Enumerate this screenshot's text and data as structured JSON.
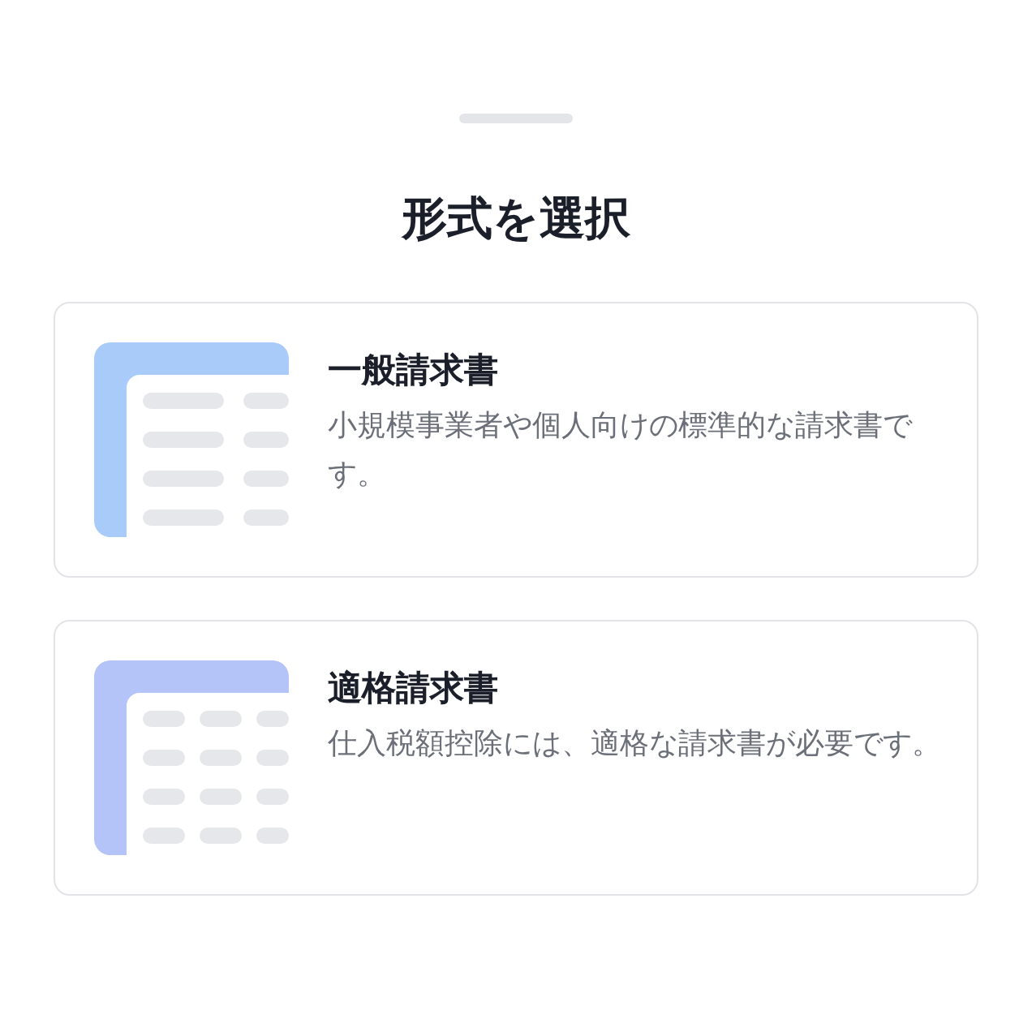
{
  "title": "形式を選択",
  "options": [
    {
      "name": "一般請求書",
      "description": "小規模事業者や個人向けの標準的な請求書です。",
      "kind": "two-column",
      "color": "#a8cbfa"
    },
    {
      "name": "適格請求書",
      "description": "仕入税額控除には、適格な請求書が必要です。",
      "kind": "three-column",
      "color": "#b5c4f8"
    }
  ]
}
